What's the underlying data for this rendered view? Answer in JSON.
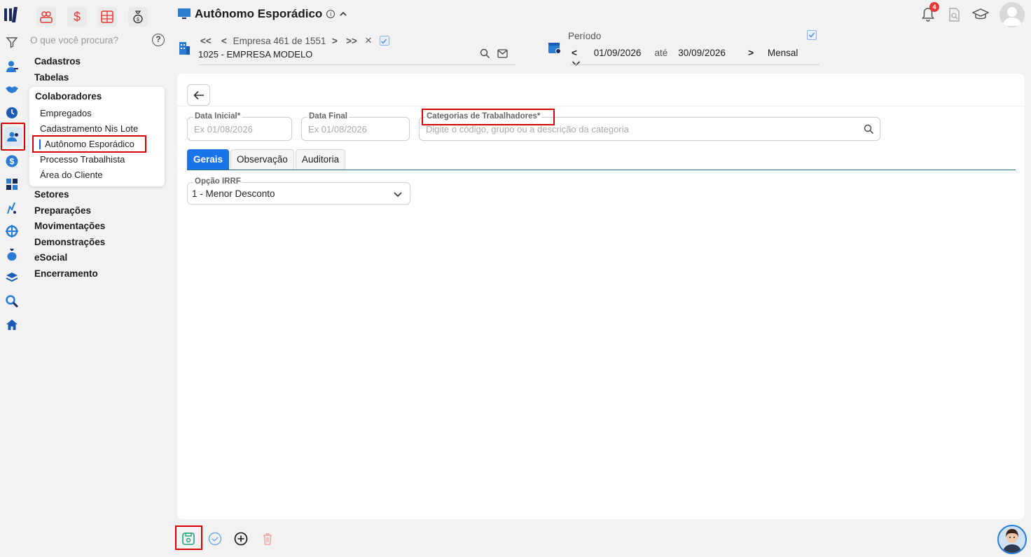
{
  "app": {
    "page_title": "Autônomo Esporádico",
    "info_glyph": "i",
    "search_placeholder": "O que você procura?",
    "help_glyph": "?"
  },
  "empresa": {
    "nav_first": "<<",
    "nav_prev": "<",
    "counter": "Empresa 461 de 1551",
    "nav_next": ">",
    "nav_last": ">>",
    "clear": "×",
    "name": "1025 - EMPRESA MODELO"
  },
  "periodo": {
    "label": "Período",
    "prev": "<",
    "start": "01/09/2026",
    "ate": "até",
    "end": "30/09/2026",
    "next": ">",
    "mode": "Mensal"
  },
  "notifications": {
    "count": "4"
  },
  "menu": {
    "top_items": [
      "Cadastros",
      "Tabelas"
    ],
    "group_title": "Colaboradores",
    "group_items": [
      "Empregados",
      "Cadastramento Nis Lote",
      "Autônomo Esporádico",
      "Processo Trabalhista",
      "Área do Cliente"
    ],
    "bottom_items": [
      "Setores",
      "Preparações",
      "Movimentações",
      "Demonstrações",
      "eSocial",
      "Encerramento"
    ]
  },
  "form": {
    "data_inicial": {
      "label": "Data Inicial*",
      "placeholder": "Ex 01/08/2026"
    },
    "data_final": {
      "label": "Data Final",
      "placeholder": "Ex 01/08/2026"
    },
    "categorias": {
      "label": "Categorias de Trabalhadores*",
      "placeholder": "Digite o código, grupo ou a descrição da categoria"
    },
    "tabs": [
      "Gerais",
      "Observação",
      "Auditoria"
    ],
    "opcao_irrf": {
      "label": "Opção IRRF",
      "value": "1 - Menor Desconto"
    }
  },
  "colors": {
    "accent": "#1a73e8",
    "highlight": "#d40000",
    "brand_red": "#e53935",
    "teal_line": "#1d6f86"
  }
}
